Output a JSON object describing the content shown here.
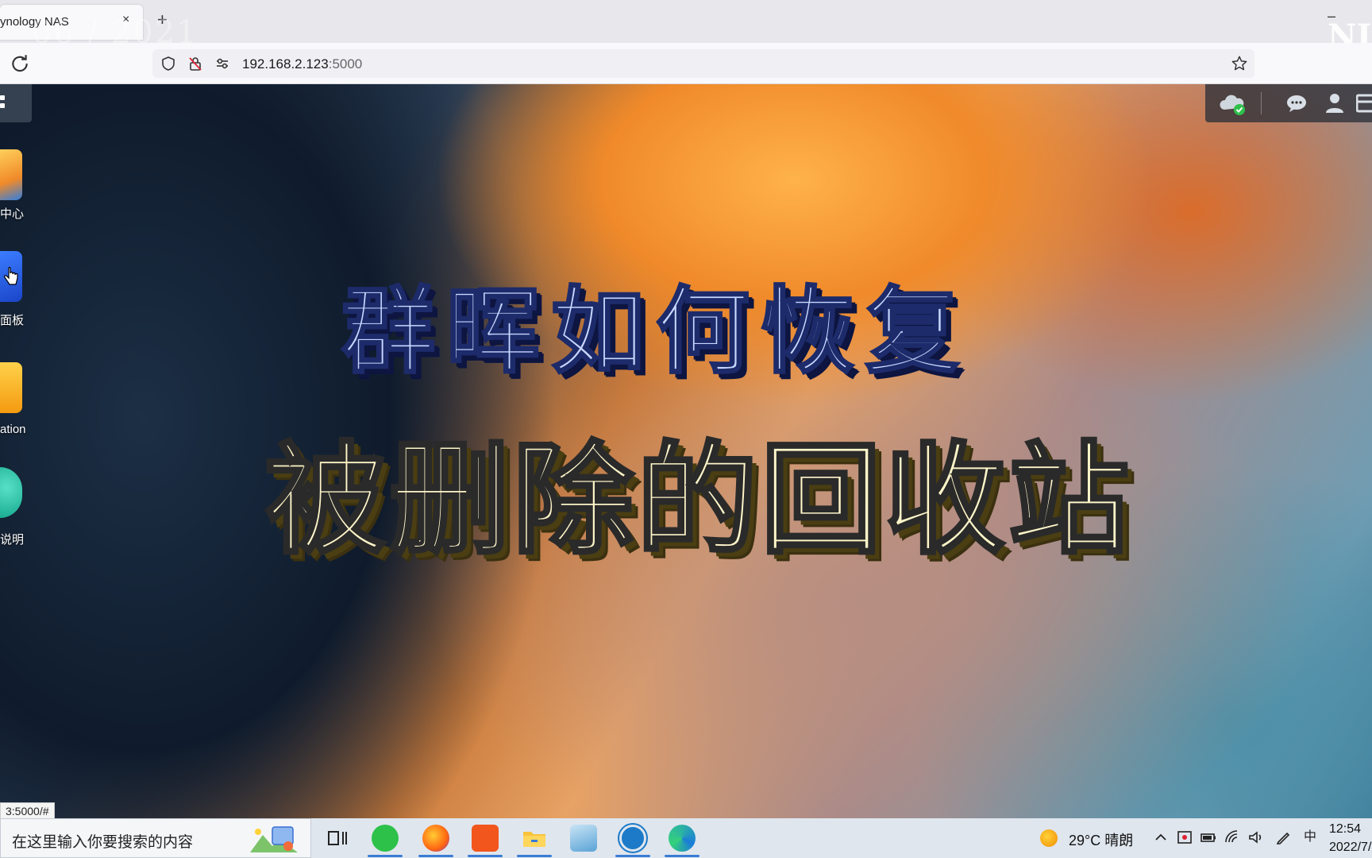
{
  "browser": {
    "tab_title": "ynology NAS",
    "tab_close": "×",
    "new_tab": "+",
    "minimize": "–",
    "url_host": "192.168.2.123",
    "url_port": ":5000",
    "watermark_date": "06 / 2021",
    "watermark_ni": "NI"
  },
  "desktop": {
    "icons": [
      {
        "label": "中心",
        "color": "#f4a13a"
      },
      {
        "label": "面板",
        "color": "#1f5fe0"
      },
      {
        "label": "ation",
        "color": "#f7b21a"
      },
      {
        "label": "说明",
        "color": "#22b8a0"
      }
    ],
    "title_line1": "群晖如何恢复",
    "title_line2": "被删除的回收站"
  },
  "status_link": "3:5000/#",
  "taskbar": {
    "search_placeholder": "在这里输入你要搜索的内容",
    "weather": "29°C  晴朗",
    "input_method": "中",
    "clock_time": "12:54",
    "clock_date": "2022/7/"
  },
  "colors": {
    "accent": "#3a7bd5",
    "title1_fill": "#c9d8ff",
    "title2_fill": "#fff6c9"
  }
}
